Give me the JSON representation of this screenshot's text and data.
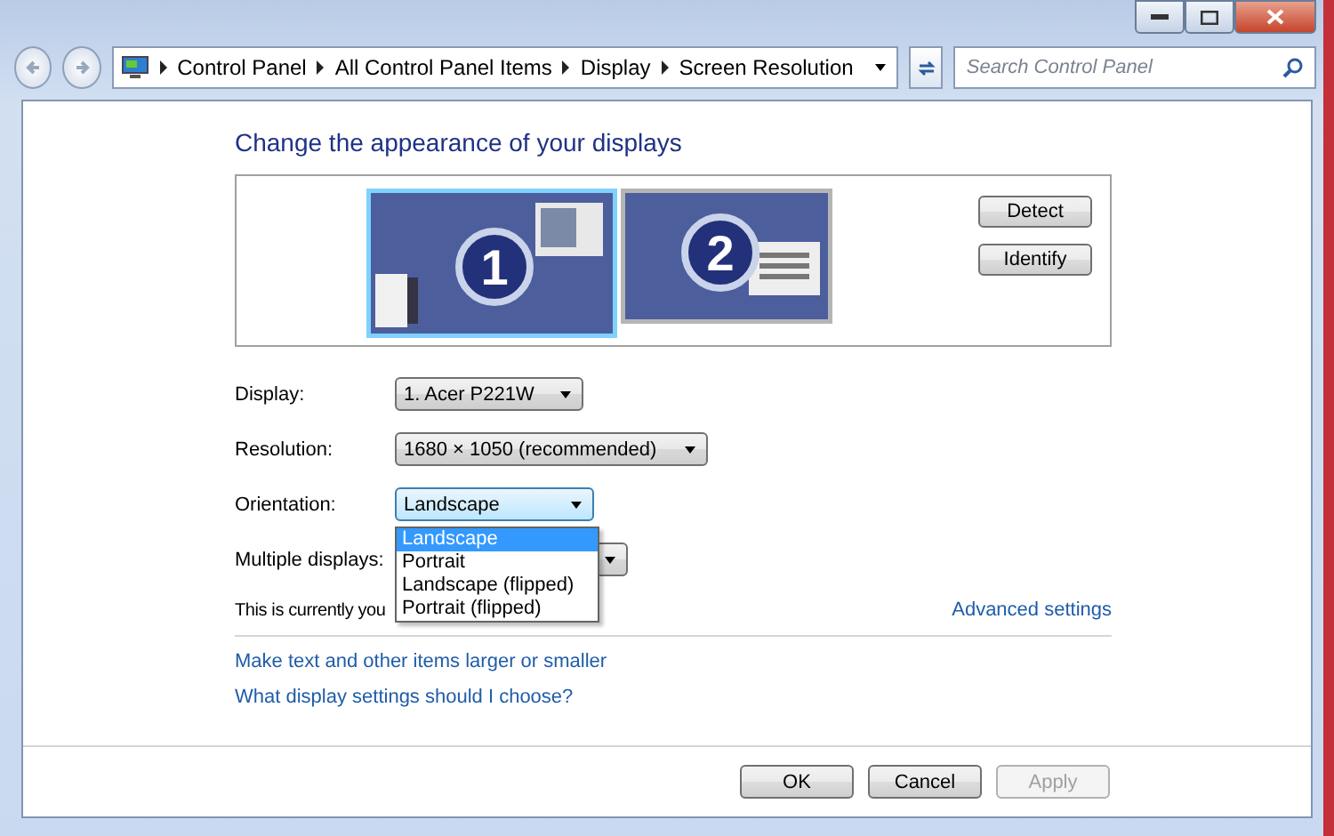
{
  "address_bar": {
    "crumbs": [
      "Control Panel",
      "All Control Panel Items",
      "Display",
      "Screen Resolution"
    ]
  },
  "search": {
    "placeholder": "Search Control Panel"
  },
  "heading": "Change the appearance of your displays",
  "monitors": [
    {
      "label": "1",
      "selected": true
    },
    {
      "label": "2",
      "selected": false
    }
  ],
  "monitor_buttons": [
    "Detect",
    "Identify"
  ],
  "settings": [
    {
      "label": "Display:",
      "value": "1. Acer P221W",
      "expanded": false
    },
    {
      "label": "Resolution:",
      "value": "1680 × 1050 (recommended)",
      "expanded": false
    },
    {
      "label": "Orientation:",
      "value": "Landscape",
      "expanded": true,
      "options": [
        {
          "label": "Landscape",
          "selected": true
        },
        {
          "label": "Portrait",
          "selected": false
        },
        {
          "label": "Landscape (flipped)",
          "selected": false
        },
        {
          "label": "Portrait (flipped)",
          "selected": false
        }
      ]
    },
    {
      "label": "Multiple displays:",
      "expanded": false
    }
  ],
  "main_display_note": "This is currently you",
  "advanced_link": "Advanced settings",
  "links": [
    "Make text and other items larger or smaller",
    "What display settings should I choose?"
  ],
  "buttons": [
    {
      "label": "OK",
      "disabled": false
    },
    {
      "label": "Cancel",
      "disabled": false
    },
    {
      "label": "Apply",
      "disabled": true
    }
  ]
}
